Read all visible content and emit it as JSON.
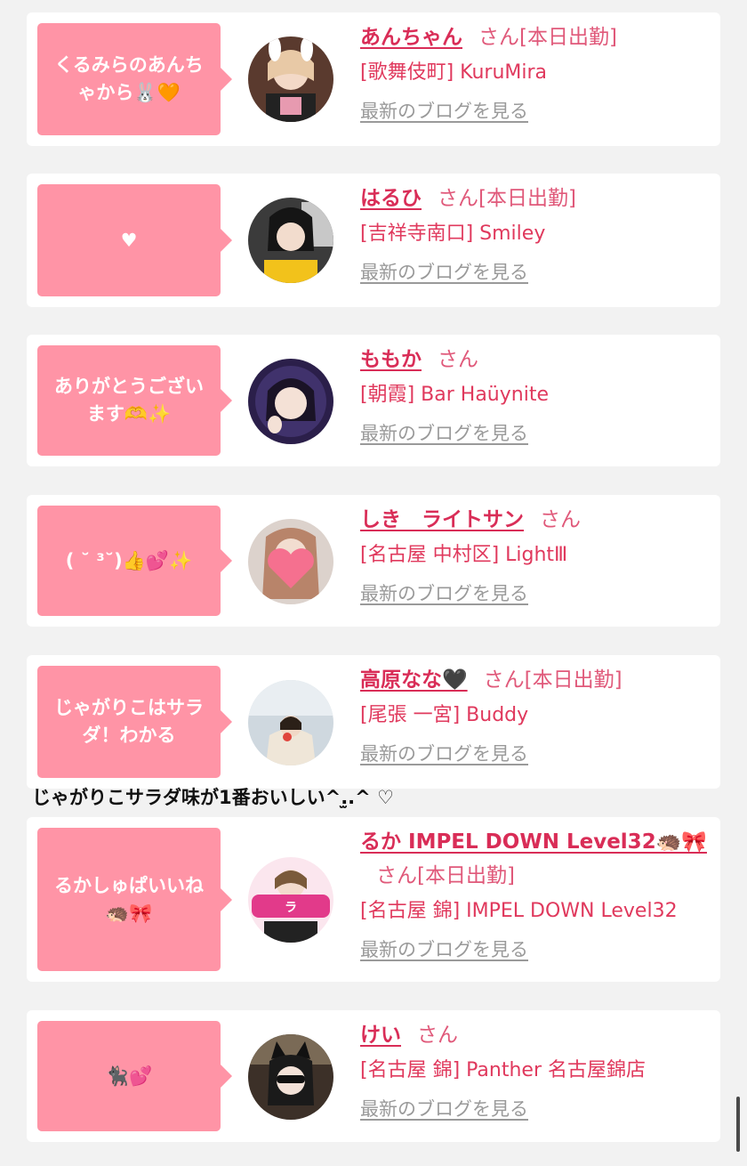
{
  "blog_link_label": "最新のブログを見る",
  "san_label": "さん",
  "entries": [
    {
      "message": "くるみらのあんちゃから🐰🧡",
      "name": "あんちゃん",
      "status": "[本日出勤]",
      "shop": "[歌舞伎町] KuruMira"
    },
    {
      "message": "♥",
      "name": "はるひ",
      "status": "[本日出勤]",
      "shop": "[吉祥寺南口] Smiley"
    },
    {
      "message": "ありがとうございます🫶✨",
      "name": "ももか",
      "status": "",
      "shop": "[朝霞] Bar Haüynite"
    },
    {
      "message": "( ˘ ³˘)👍💕✨",
      "name": "しき　ライトサン",
      "status": "",
      "shop": "[名古屋 中村区] LightⅢ"
    },
    {
      "message": "じゃがりこはサラダ！わかる",
      "name": "高原なな🖤",
      "status": "[本日出勤]",
      "shop": "[尾張 一宮] Buddy"
    },
    {
      "message": "るかしゅぱいいね🦔🎀",
      "name": "るか IMPEL DOWN Level32🦔🎀",
      "status": "[本日出勤]",
      "shop": "[名古屋 錦] IMPEL DOWN Level32"
    },
    {
      "message": "🐈‍⬛💕",
      "name": "けい",
      "status": "",
      "shop": "[名古屋 錦] Panther 名古屋錦店"
    }
  ],
  "comment": "じゃがりこサラダ味が1番おいしい^.̫.^ ♡",
  "colors": {
    "bubble": "#ff94a6",
    "name": "#d92d57",
    "link": "#9a9a9a",
    "background": "#f2f2f2"
  }
}
